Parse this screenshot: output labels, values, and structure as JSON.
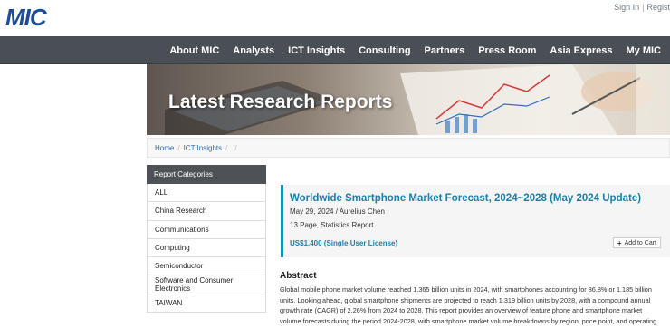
{
  "header": {
    "logo": "MIC",
    "sign_in": "Sign In",
    "separator": "|",
    "register": "Regist"
  },
  "nav": {
    "items": [
      "About MIC",
      "Analysts",
      "ICT Insights",
      "Consulting",
      "Partners",
      "Press Room",
      "Asia Express",
      "My MIC"
    ]
  },
  "banner": {
    "title": "Latest Research Reports"
  },
  "breadcrumb": {
    "home": "Home",
    "section": "ICT Insights"
  },
  "sidebar": {
    "heading": "Report Categories",
    "items": [
      "ALL",
      "China Research",
      "Communications",
      "Computing",
      "Semiconductor",
      "Software and Consumer Electronics",
      "TAIWAN"
    ]
  },
  "report": {
    "title": "Worldwide Smartphone Market Forecast, 2024~2028 (May 2024 Update)",
    "date_author": "May 29, 2024 / Aurelius Chen",
    "pages": "13 Page, Statistics Report",
    "price": "US$1,400 (Single User License)",
    "add_to_cart": "Add to Cart"
  },
  "abstract": {
    "heading": "Abstract",
    "text": "Global mobile phone market volume reached 1.365 billion units in 2024, with smartphones accounting for 86.8% or 1.185 billion units. Looking ahead, global smartphone shipments are projected to reach 1.319 billion units by 2028, with a compound annual growth rate (CAGR) of 2.26% from 2024 to 2028. This report provides an overview of feature phone and smartphone market volume forecasts during the period 2024-2028, with smartphone market volume breakdowns by region, price point, and operating system."
  },
  "colors": {
    "brand_blue": "#1d4d96",
    "nav_bg": "#4a4f55",
    "accent": "#1b7fa8"
  }
}
